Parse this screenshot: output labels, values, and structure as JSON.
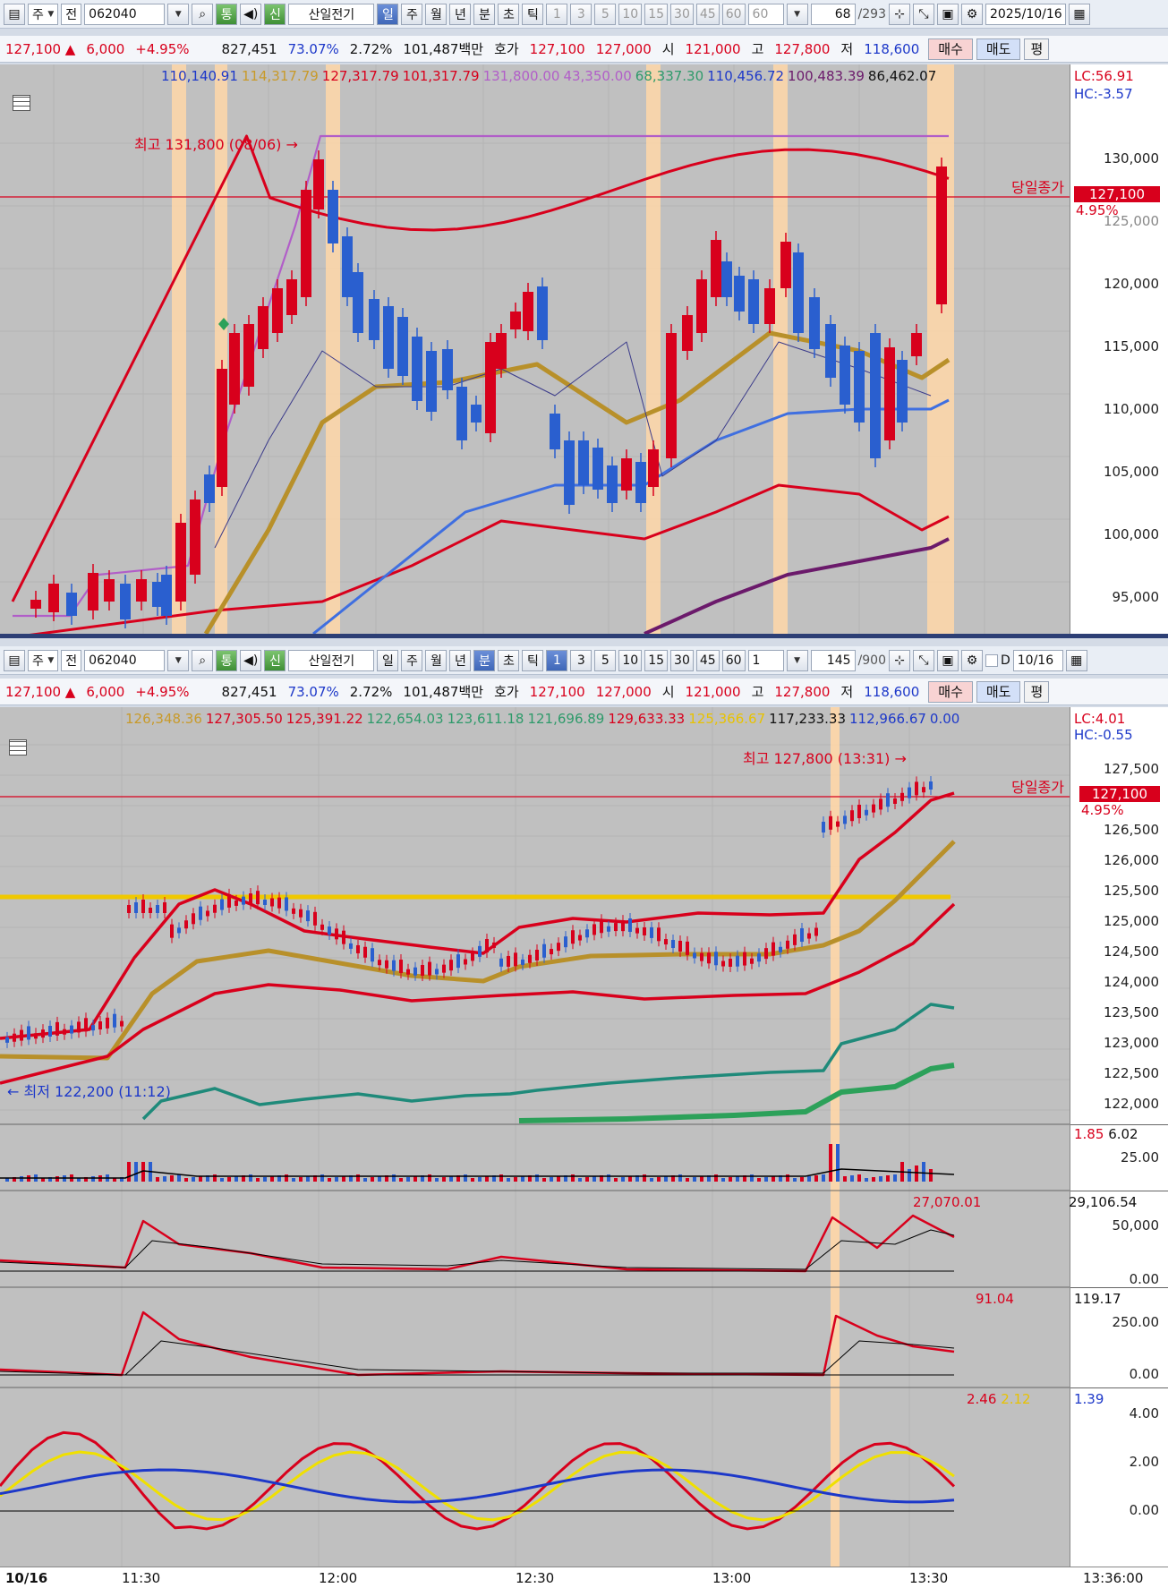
{
  "toolbar_top": {
    "type_label": "주",
    "prefix_label": "전",
    "code": "062040",
    "tong_label": "통",
    "shin_label": "신",
    "stock_name": "산일전기",
    "periods": [
      "일",
      "주",
      "월",
      "년",
      "분",
      "초",
      "틱"
    ],
    "active_period": "일",
    "intervals": [
      "1",
      "3",
      "5",
      "10",
      "15",
      "30",
      "45",
      "60"
    ],
    "interval_select": "60",
    "count_value": "68",
    "count_total": "/293",
    "date": "2025/10/16"
  },
  "toolbar_bottom": {
    "type_label": "주",
    "prefix_label": "전",
    "code": "062040",
    "tong_label": "통",
    "shin_label": "신",
    "stock_name": "산일전기",
    "periods": [
      "일",
      "주",
      "월",
      "년",
      "분",
      "초",
      "틱"
    ],
    "active_period": "분",
    "intervals": [
      "1",
      "3",
      "5",
      "10",
      "15",
      "30",
      "45",
      "60"
    ],
    "active_interval": "1",
    "interval_select": "1",
    "count_value": "145",
    "count_total": "/900",
    "checkbox_label": "D",
    "date": "10/16"
  },
  "quote": {
    "price": "127,100",
    "change": "6,000",
    "change_pct": "+4.95%",
    "volume": "827,451",
    "vol_ratio": "73.07%",
    "turnover": "2.72%",
    "amount": "101,487백만",
    "hoga_label": "호가",
    "ask": "127,100",
    "bid": "127,000",
    "open_label": "시",
    "open": "121,000",
    "high_label": "고",
    "high": "127,800",
    "low_label": "저",
    "low": "118,600",
    "buy_label": "매수",
    "sell_label": "매도",
    "eval_label": "평"
  },
  "daily_chart": {
    "legend": [
      {
        "text": "110,140.91",
        "color": "#1d38c9"
      },
      {
        "text": "114,317.79",
        "color": "#c89a2a"
      },
      {
        "text": "127,317.79",
        "color": "#d8001c"
      },
      {
        "text": "101,317.79",
        "color": "#d8001c"
      },
      {
        "text": "131,800.00",
        "color": "#b15ec8"
      },
      {
        "text": "43,350.00",
        "color": "#b15ec8"
      },
      {
        "text": "68,337.30",
        "color": "#2e9a6a"
      },
      {
        "text": "110,456.72",
        "color": "#1d38c9"
      },
      {
        "text": "100,483.39",
        "color": "#6b1a6b"
      },
      {
        "text": "86,462.07",
        "color": "#111111"
      }
    ],
    "legend_name": "산일전기",
    "lc": "LC:56.91",
    "hc": "HC:-3.57",
    "high_marker": "최고 131,800 (08/06)",
    "close_label": "당일종가",
    "close_price": "127,100",
    "close_pct": "4.95%",
    "y_ticks": [
      "130,000",
      "125,000",
      "120,000",
      "115,000",
      "110,000",
      "105,000",
      "100,000",
      "95,000"
    ]
  },
  "minute_chart": {
    "legend": [
      {
        "text": "126,348.36",
        "color": "#c89a2a"
      },
      {
        "text": "127,305.50",
        "color": "#d8001c"
      },
      {
        "text": "125,391.22",
        "color": "#d8001c"
      },
      {
        "text": "122,654.03",
        "color": "#2e9a6a"
      },
      {
        "text": "123,611.18",
        "color": "#2e9a6a"
      },
      {
        "text": "121,696.89",
        "color": "#2e9a6a"
      },
      {
        "text": "129,633.33",
        "color": "#d8001c"
      },
      {
        "text": "125,366.67",
        "color": "#e8c200"
      },
      {
        "text": "117,233.33",
        "color": "#111111"
      },
      {
        "text": "112,966.67",
        "color": "#1d38c9"
      },
      {
        "text": "0.00",
        "color": "#1d38c9"
      }
    ],
    "legend_name": "산일전기",
    "lc": "LC:4.01",
    "hc": "HC:-0.55",
    "high_marker": "최고 127,800 (13:31)",
    "low_marker": "최저 122,200 (11:12)",
    "close_label": "당일종가",
    "close_price": "127,100",
    "close_pct": "4.95%",
    "y_ticks": [
      "127,500",
      "126,500",
      "126,000",
      "125,500",
      "125,000",
      "124,500",
      "124,000",
      "123,500",
      "123,000",
      "122,500",
      "122,000"
    ],
    "vol_legend": [
      "1.85",
      "6.02"
    ],
    "vol_tick": "25.00",
    "ind1_legend": [
      "27,070.01",
      "29,106.54"
    ],
    "ind1_ticks": [
      "50,000",
      "0.00"
    ],
    "ind2_legend": [
      "91.04",
      "119.17"
    ],
    "ind2_ticks": [
      "250.00",
      "0.00"
    ],
    "ind3_legend": [
      "2.46",
      "2.12",
      "1.39"
    ],
    "ind3_ticks": [
      "4.00",
      "2.00",
      "0.00"
    ],
    "x_date": "10/16",
    "x_ticks": [
      "11:30",
      "12:00",
      "12:30",
      "13:00",
      "13:30"
    ],
    "x_end": "13:36:00"
  },
  "colors": {
    "up": "#d8001c",
    "down": "#2a5fcf",
    "ma_gold": "#b8902a",
    "highlight": "#ffd7a8",
    "yellow_line": "#f0c800"
  }
}
